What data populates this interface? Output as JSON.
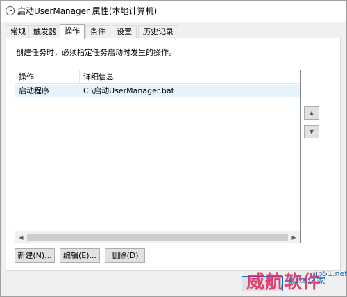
{
  "window": {
    "title": "启动UserManager 属性(本地计算机)",
    "icon": "clock-icon"
  },
  "tabs": [
    {
      "label": "常规"
    },
    {
      "label": "触发器"
    },
    {
      "label": "操作",
      "active": true
    },
    {
      "label": "条件"
    },
    {
      "label": "设置"
    },
    {
      "label": "历史记录"
    }
  ],
  "panel": {
    "instruction": "创建任务时，必须指定任务启动时发生的操作。"
  },
  "listview": {
    "columns": [
      "操作",
      "详细信息"
    ],
    "rows": [
      {
        "action": "启动程序",
        "details": "C:\\启动UserManager.bat"
      }
    ]
  },
  "buttons": {
    "new": "新建(N)...",
    "edit": "编辑(E)...",
    "delete": "删除(D)"
  },
  "side_buttons": {
    "up_icon": "arrow-up-icon",
    "down_icon": "arrow-down-icon"
  },
  "watermark": {
    "main": "威航软件",
    "sub": "脚本之家",
    "url": "jb51.net"
  },
  "colors": {
    "window_bg": "#f0f0f0",
    "panel_bg": "#ffffff",
    "selected_row": "#e5f3ff",
    "focus_border": "#0078d7",
    "watermark_red": "#e0245e",
    "watermark_blue": "#1e6fb8"
  }
}
